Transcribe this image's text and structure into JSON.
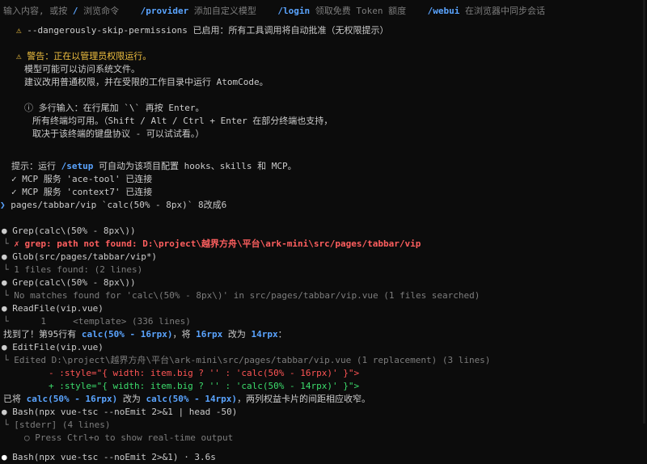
{
  "hints": {
    "input_hint": "输入内容, 或按",
    "cmd1": "/",
    "cmd1_desc": "浏览命令",
    "cmd2": "/provider",
    "cmd2_desc": "添加自定义模型",
    "cmd3": "/login",
    "cmd3_desc": "领取免费 Token 额度",
    "cmd4": "/webui",
    "cmd4_desc": "在浏览器中同步会话"
  },
  "skip_perm": "--dangerously-skip-permissions 已启用：所有工具调用将自动批准（无权限提示）",
  "warn": {
    "title": "警告：正在以管理员权限运行。",
    "line1": "模型可能可以访问系统文件。",
    "line2": "建议改用普通权限，并在受限的工作目录中运行 AtomCode。"
  },
  "multiline": {
    "line1": "ⓘ 多行输入：在行尾加 `\\` 再按 Enter。",
    "line2": "所有终端均可用。（Shift / Alt / Ctrl + Enter 在部分终端也支持，",
    "line3": "取决于该终端的键盘协议 - 可以试试看。）"
  },
  "setup": {
    "prefix": "提示：运行",
    "cmd": "/setup",
    "suffix": "可自动为该项目配置 hooks、skills 和 MCP。"
  },
  "mcp1": "✓ MCP 服务 'ace-tool' 已连接",
  "mcp2": "✓ MCP 服务 'context7' 已连接",
  "user_prompt": "pages/tabbar/vip `calc(50% - 8px)` 8改成6",
  "tool1": {
    "call": "Grep(calc\\(50% - 8px\\))",
    "err": "✗ grep: path not found: D:\\project\\越界方舟\\平台\\ark-mini\\src/pages/tabbar/vip"
  },
  "tool2": {
    "call": "Glob(src/pages/tabbar/vip*)",
    "out": "1 files found: (2 lines)"
  },
  "tool3": {
    "call": "Grep(calc\\(50% - 8px\\))",
    "out": "No matches found for 'calc\\(50% - 8px\\)' in src/pages/tabbar/vip.vue (1 files searched)"
  },
  "tool4": {
    "call": "ReadFile(vip.vue)",
    "num": "1",
    "out": "<template> (336 lines)"
  },
  "found": {
    "a": "找到了！第95行有",
    "b": "calc(50% - 16rpx)",
    "c": "，将",
    "d": "16rpx",
    "e": "改为",
    "f": "14rpx",
    "g": "："
  },
  "tool5": {
    "call": "EditFile(vip.vue)",
    "out": "Edited D:\\project\\越界方舟\\平台\\ark-mini\\src/pages/tabbar/vip.vue (1 replacement) (3 lines)",
    "minus": "- :style=\"{ width: item.big ? '' : 'calc(50% - 16rpx)' }\">",
    "plus": "+ :style=\"{ width: item.big ? '' : 'calc(50% - 14rpx)' }\">"
  },
  "done": {
    "a": "已将",
    "b": "calc(50% - 16rpx)",
    "c": "改为",
    "d": "calc(50% - 14rpx)",
    "e": "，两列权益卡片的间距相应收窄。"
  },
  "tool6": {
    "call": "Bash(npx vue-tsc --noEmit 2>&1 | head -50)",
    "out": "[stderr] (4 lines)",
    "hint": "○ Press Ctrl+o to show real-time output"
  },
  "tool7": {
    "call": "Bash(npx vue-tsc --noEmit 2>&1)",
    "time": "· 3.6s"
  },
  "glyphs": {
    "bullet": "●",
    "branch": "└",
    "warn": "⚠",
    "prompt": "❯"
  },
  "colors": {
    "background": "#0c0c0c",
    "text": "#cccccc",
    "accent": "#5aa4ff",
    "error": "#ff5f5f",
    "added": "#3cdc6c",
    "warning": "#f0c040"
  }
}
